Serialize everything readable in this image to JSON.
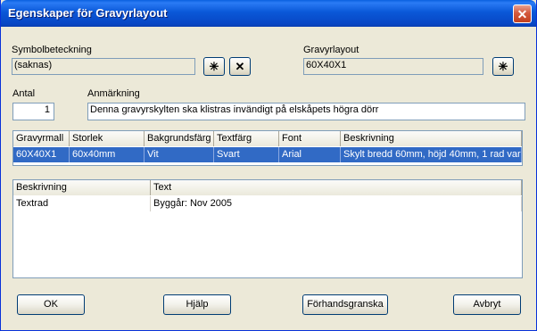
{
  "window": {
    "title": "Egenskaper för Gravyrlayout",
    "close_glyph": "✕"
  },
  "symbol": {
    "label": "Symbolbeteckning",
    "value": "(saknas)",
    "asterisk_glyph": "✳",
    "clear_glyph": "✕"
  },
  "layout": {
    "label": "Gravyrlayout",
    "value": "60X40X1",
    "asterisk_glyph": "✳"
  },
  "count": {
    "label": "Antal",
    "value": "1"
  },
  "remark": {
    "label": "Anmärkning",
    "value": "Denna gravyrskylten ska klistras invändigt på elskåpets högra dörr"
  },
  "template_table": {
    "columns": [
      "Gravyrmall",
      "Storlek",
      "Bakgrundsfärg",
      "Textfärg",
      "Font",
      "Beskrivning"
    ],
    "rows": [
      [
        "60X40X1",
        "60x40mm",
        "Vit",
        "Svart",
        "Arial",
        "Skylt bredd 60mm, höjd 40mm, 1 rad varia"
      ]
    ]
  },
  "text_table": {
    "columns": [
      "Beskrivning",
      "Text"
    ],
    "rows": [
      [
        "Textrad",
        "Byggår: Nov 2005"
      ]
    ]
  },
  "buttons": {
    "ok": "OK",
    "help": "Hjälp",
    "preview": "Förhandsgranska",
    "cancel": "Avbryt"
  }
}
